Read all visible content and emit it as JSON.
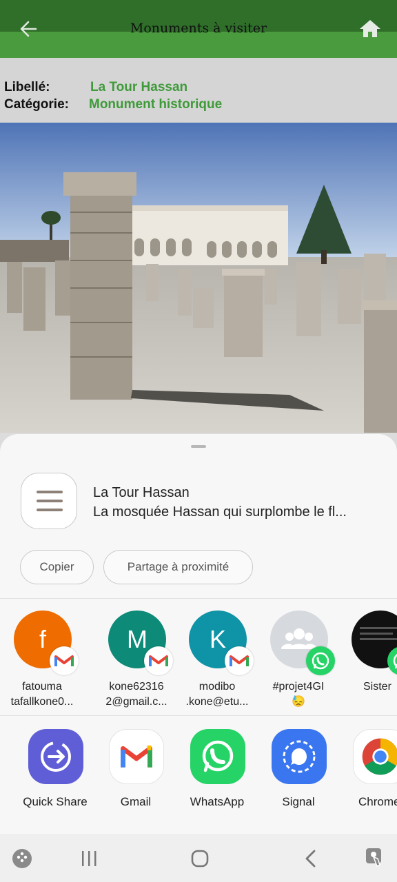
{
  "app_bar": {
    "title": "Monuments à visiter"
  },
  "info": {
    "label_name": "Libellé:",
    "value_name": "La Tour Hassan",
    "label_category": "Catégorie:",
    "value_category": "Monument historique"
  },
  "share_sheet": {
    "title": "La Tour Hassan",
    "description": "La mosquée Hassan qui surplombe le fl...",
    "copy_label": "Copier",
    "nearby_label": "Partage à proximité",
    "contacts": [
      {
        "initial": "f",
        "line1": "fatouma",
        "line2": "tafallkone0...",
        "color": "#ee6c00",
        "badge": "gmail-icon"
      },
      {
        "initial": "M",
        "line1": "kone62316",
        "line2": "2@gmail.c...",
        "color": "#0d8a78",
        "badge": "gmail-icon"
      },
      {
        "initial": "K",
        "line1": "modibo",
        "line2": ".kone@etu...",
        "color": "#0f93a6",
        "badge": "gmail-icon"
      },
      {
        "initial": "",
        "line1": "#projet4GI",
        "line2": "😓",
        "color": "#d6d9dd",
        "badge": "whatsapp-icon"
      },
      {
        "initial": "",
        "line1": "Sister",
        "line2": "",
        "color": "#111111",
        "badge": "whatsapp-icon"
      }
    ],
    "apps": [
      {
        "name": "Quick Share",
        "icon": "quick-share-icon"
      },
      {
        "name": "Gmail",
        "icon": "gmail-icon"
      },
      {
        "name": "WhatsApp",
        "icon": "whatsapp-icon"
      },
      {
        "name": "Signal",
        "icon": "signal-icon"
      },
      {
        "name": "Chrome",
        "icon": "chrome-icon"
      }
    ]
  },
  "colors": {
    "app_bar": "#4a9a3e",
    "app_bar_dark": "#2f6f2a",
    "value_text": "#3f9a3a"
  }
}
